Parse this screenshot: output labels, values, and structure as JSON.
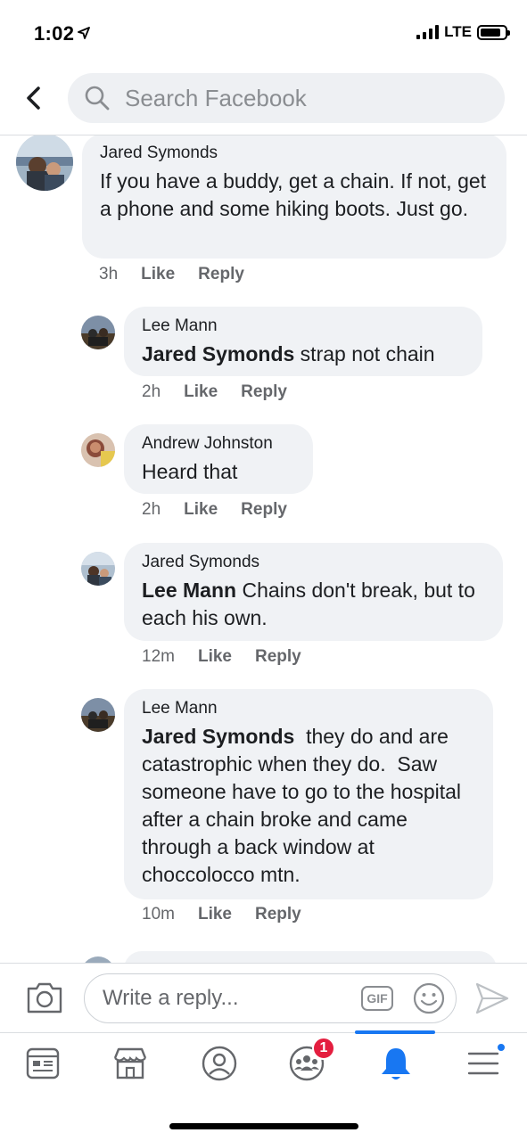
{
  "status_bar": {
    "time": "1:02",
    "network": "LTE"
  },
  "header": {
    "search_placeholder": "Search Facebook"
  },
  "comments": [
    {
      "author": "Jared Symonds",
      "mention": "",
      "text": "If you have a buddy, get a chain. If not, get a phone and some hiking boots. Just go.",
      "time": "3h",
      "like": "Like",
      "reply": "Reply"
    },
    {
      "author": "Lee Mann",
      "mention": "Jared Symonds",
      "text": " strap not chain",
      "time": "2h",
      "like": "Like",
      "reply": "Reply"
    },
    {
      "author": "Andrew Johnston",
      "mention": "",
      "text": "Heard that",
      "time": "2h",
      "like": "Like",
      "reply": "Reply"
    },
    {
      "author": "Jared Symonds",
      "mention": "Lee Mann",
      "text": " Chains don't break, but to each his own.",
      "time": "12m",
      "like": "Like",
      "reply": "Reply"
    },
    {
      "author": "Lee Mann",
      "mention": "Jared Symonds",
      "text": "  they do and are catastrophic when they do.  Saw someone have to go to the hospital after a chain broke and came through a back window at choccolocco mtn.",
      "time": "10m",
      "like": "Like",
      "reply": "Reply"
    }
  ],
  "composer": {
    "placeholder": "Write a reply...",
    "gif_label": "GIF"
  },
  "tabbar": {
    "items": [
      {
        "name": "news-feed",
        "icon": "newsfeed-icon"
      },
      {
        "name": "marketplace",
        "icon": "storefront-icon"
      },
      {
        "name": "profile",
        "icon": "profile-icon"
      },
      {
        "name": "groups",
        "icon": "groups-icon",
        "badge": "1"
      },
      {
        "name": "notifications",
        "icon": "bell-icon",
        "active": true
      },
      {
        "name": "menu",
        "icon": "hamburger-menu-icon"
      }
    ]
  },
  "colors": {
    "accent": "#1877f2",
    "bubble": "#f0f2f5",
    "badge": "#e41e3f",
    "muted": "#65676b"
  }
}
